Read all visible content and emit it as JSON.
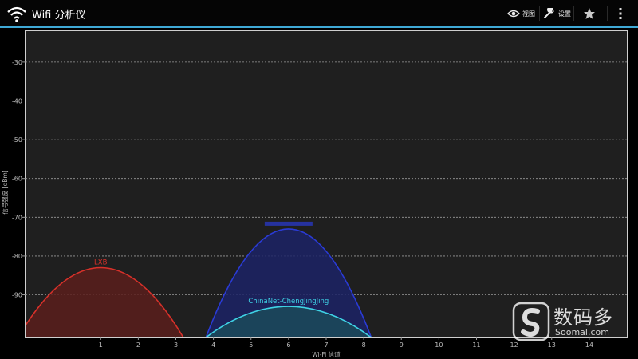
{
  "app": {
    "title": "Wifi 分析仪"
  },
  "actions": {
    "view_label": "视图",
    "settings_label": "设置"
  },
  "chart_data": {
    "type": "area",
    "xlabel": "Wi-Fi 信道",
    "ylabel": "信号强度 [dBm]",
    "xlim": [
      -1,
      15
    ],
    "ylim": [
      -101,
      -22
    ],
    "x_ticks": [
      1,
      2,
      3,
      4,
      5,
      6,
      7,
      8,
      9,
      10,
      11,
      12,
      13,
      14
    ],
    "y_ticks": [
      -30,
      -40,
      -50,
      -60,
      -70,
      -80,
      -90
    ],
    "grid": true,
    "series": [
      {
        "name": "LXB",
        "channel": 1,
        "half_width": 2.2,
        "peak_dbm": -83,
        "color": "#d8312a",
        "fill": "#5a1e1c"
      },
      {
        "name": "",
        "channel": 6,
        "half_width": 2.2,
        "peak_dbm": -73,
        "color": "#2a3bd6",
        "fill": "#1c2366"
      },
      {
        "name": "ChinaNet-ChengJingJing",
        "channel": 6,
        "half_width": 2.2,
        "peak_dbm": -93,
        "color": "#3fd3e6",
        "fill": "#1b4a5a"
      }
    ]
  },
  "watermark": {
    "brand": "数码多",
    "domain": "Soomal.com"
  }
}
